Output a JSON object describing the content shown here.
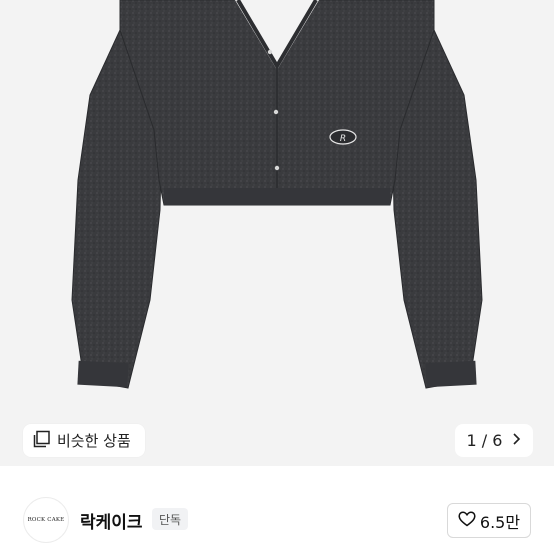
{
  "product": {
    "image_alt": "cropped gray fuzzy cardigan",
    "similar_label": "비슷한 상품",
    "page_current": "1",
    "page_separator": "/",
    "page_total": "6"
  },
  "shop": {
    "logo_text": "ROCK CAKE",
    "name": "락케이크",
    "badge": "단독",
    "like_count": "6.5만"
  },
  "icons": {
    "similar": "similar-items-icon",
    "next": "chevron-right-icon",
    "like": "heart-outline-icon"
  },
  "colors": {
    "garment": "#3a3b3e",
    "background": "#f3f3f3"
  }
}
